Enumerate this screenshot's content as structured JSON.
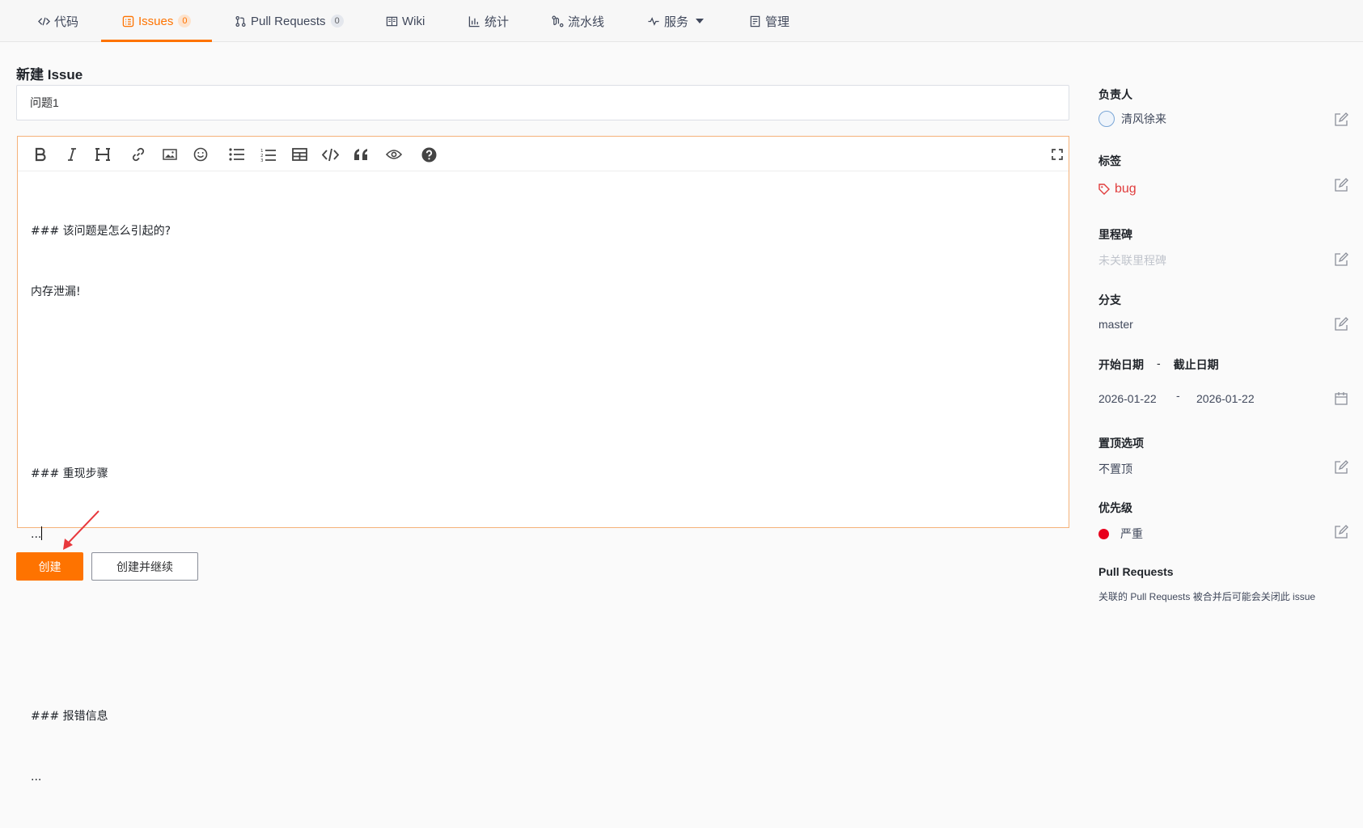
{
  "nav": {
    "tabs": [
      {
        "label": "代码",
        "icon": "code-icon"
      },
      {
        "label": "Issues",
        "count": "0",
        "icon": "issues-icon",
        "active": true
      },
      {
        "label": "Pull Requests",
        "count": "0",
        "icon": "pull-request-icon"
      },
      {
        "label": "Wiki",
        "icon": "book-icon"
      },
      {
        "label": "统计",
        "icon": "bar-chart-icon"
      },
      {
        "label": "流水线",
        "icon": "pipeline-icon"
      },
      {
        "label": "服务",
        "icon": "activity-icon",
        "dropdown": true
      },
      {
        "label": "管理",
        "icon": "document-icon"
      }
    ],
    "accent_color": "#fe7300"
  },
  "form": {
    "heading": "新建 Issue",
    "title_value": "问题1",
    "toolbar_icons": [
      "bold-icon",
      "italic-icon",
      "heading-icon",
      "link-icon",
      "image-icon",
      "emoji-icon",
      "bullet-list-icon",
      "numbered-list-icon",
      "table-icon",
      "code-icon",
      "quote-icon",
      "preview-eye-icon",
      "help-icon",
      "fullscreen-icon"
    ],
    "body_lines": [
      "### 该问题是怎么引起的?",
      "内存泄漏!",
      "",
      "",
      "### 重现步骤",
      "...",
      "",
      "",
      "### 报错信息",
      "..."
    ],
    "create_label": "创建",
    "create_continue_label": "创建并继续"
  },
  "sidebar": {
    "assignee": {
      "label": "负责人",
      "value": "清风徐来"
    },
    "labels": {
      "label": "标签",
      "value": "bug",
      "color": "#e03c3c"
    },
    "milestone": {
      "label": "里程碑",
      "value": "未关联里程碑"
    },
    "branch": {
      "label": "分支",
      "value": "master"
    },
    "dates": {
      "start_label": "开始日期",
      "sep": "-",
      "end_label": "截止日期",
      "start_value": "2026-01-22",
      "end_value": "2026-01-22"
    },
    "pin": {
      "label": "置顶选项",
      "value": "不置顶"
    },
    "priority": {
      "label": "优先级",
      "value": "严重",
      "color": "#e8001c"
    },
    "pull_requests": {
      "label": "Pull Requests",
      "note": "关联的 Pull Requests 被合并后可能会关闭此 issue"
    }
  }
}
